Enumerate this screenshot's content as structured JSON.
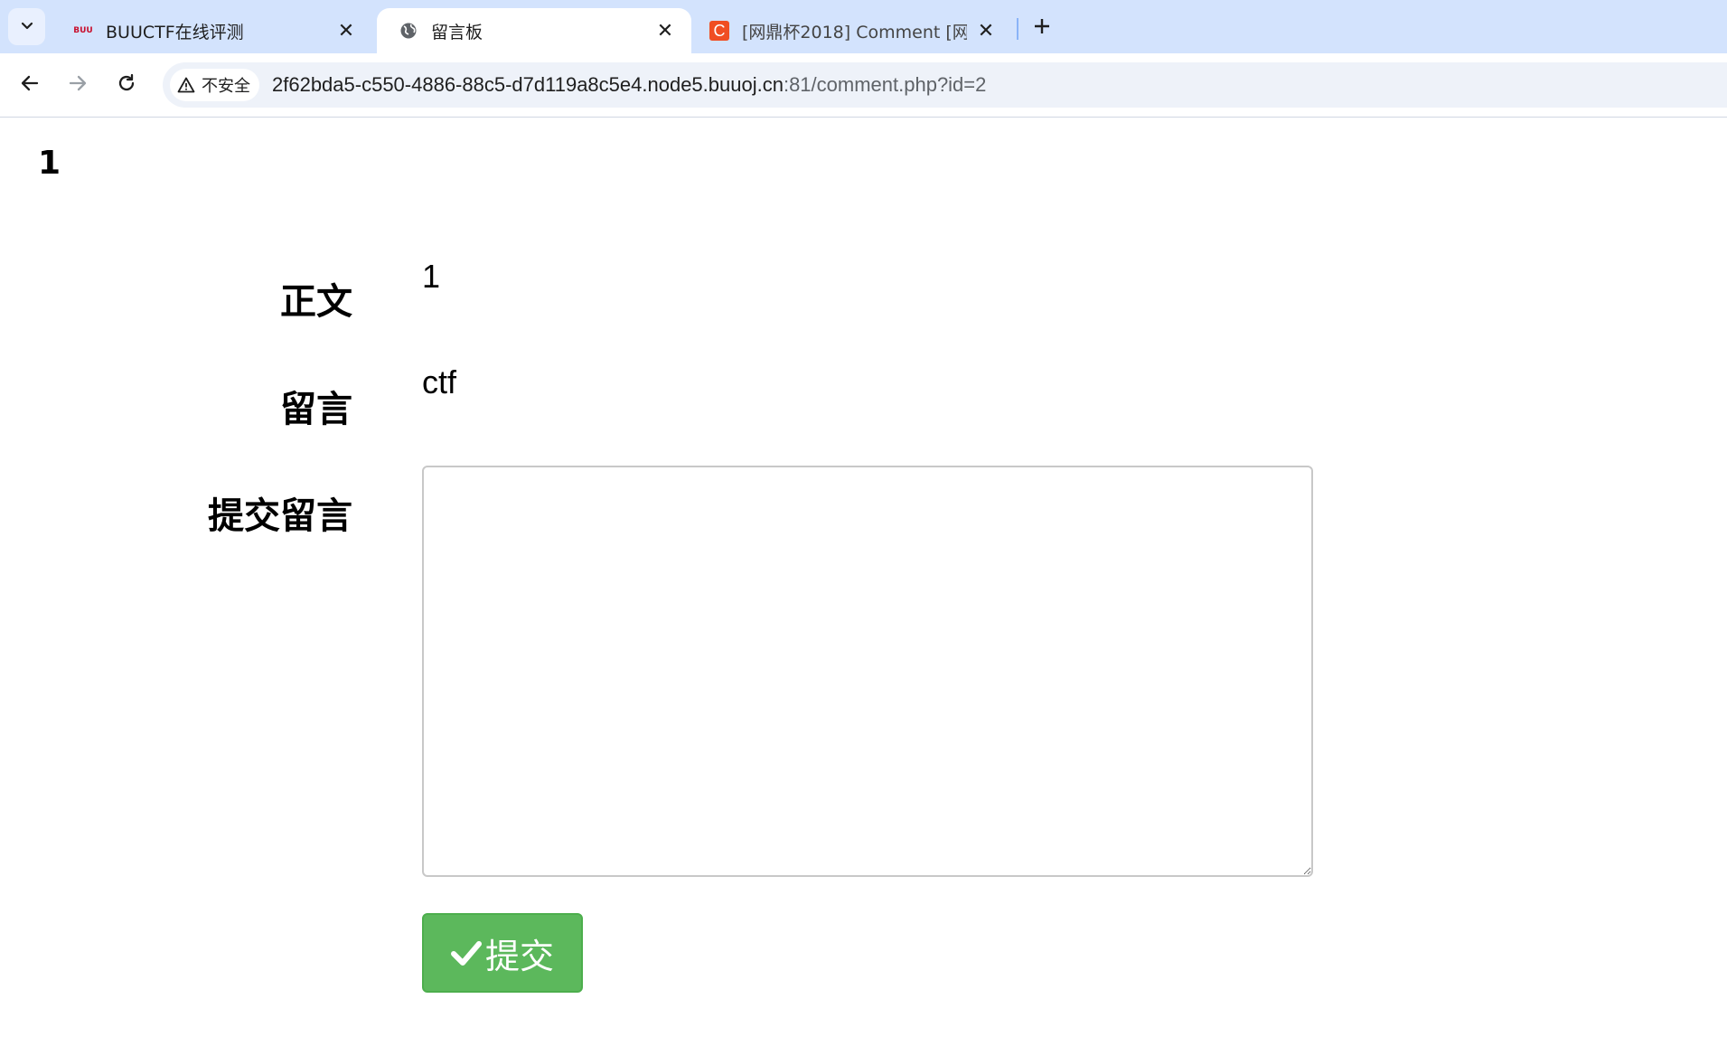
{
  "browser": {
    "tabs": [
      {
        "title": "BUUCTF在线评测",
        "icon": "buuctf-favicon-icon",
        "active": false
      },
      {
        "title": "留言板",
        "icon": "globe-icon",
        "active": true
      },
      {
        "title": "[网鼎杯2018] Comment [网鼎",
        "icon": "c-favicon-icon",
        "active": false
      }
    ],
    "security_label": "不安全",
    "url_host": "2f62bda5-c550-4886-88c5-d7d119a8c5e4.node5.buuoj.cn",
    "url_rest": ":81/comment.php?id=2",
    "favicon_c_letter": "C",
    "favicon_buu_text": "BUU"
  },
  "page": {
    "heading": "1",
    "rows": [
      {
        "label": "正文",
        "value": "1"
      },
      {
        "label": "留言",
        "value": "ctf"
      }
    ],
    "comment_label": "提交留言",
    "comment_value": "",
    "submit_label": "提交"
  },
  "colors": {
    "tabstrip": "#d3e3fd",
    "submit": "#5cb85c",
    "c_favicon": "#f04e23"
  }
}
